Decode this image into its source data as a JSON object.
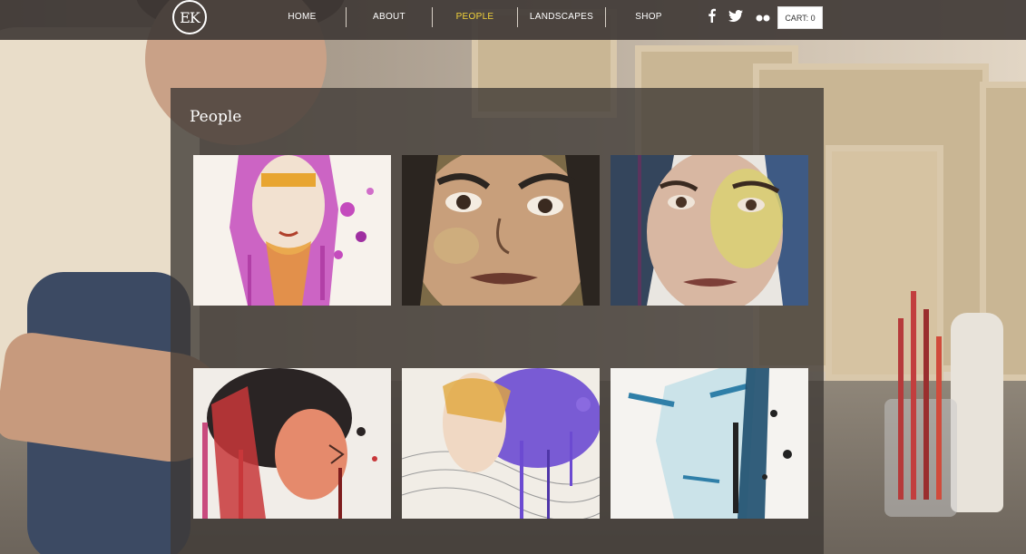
{
  "header": {
    "logo_text": "EK",
    "nav": [
      {
        "label": "HOME"
      },
      {
        "label": "ABOUT"
      },
      {
        "label": "PEOPLE"
      },
      {
        "label": "LANDSCAPES"
      },
      {
        "label": "SHOP"
      }
    ],
    "active_nav": "PEOPLE",
    "accent_color": "#f2d33a",
    "social": [
      {
        "icon": "facebook-icon"
      },
      {
        "icon": "twitter-icon"
      },
      {
        "icon": "flickr-icon"
      }
    ],
    "cart_label": "CART: 0"
  },
  "gallery": {
    "title": "People",
    "items": [
      {
        "name": "portrait-magenta-drips"
      },
      {
        "name": "portrait-child"
      },
      {
        "name": "portrait-yellow-face"
      },
      {
        "name": "portrait-red-profile"
      },
      {
        "name": "portrait-purple-hair"
      },
      {
        "name": "portrait-blue-man"
      }
    ]
  }
}
